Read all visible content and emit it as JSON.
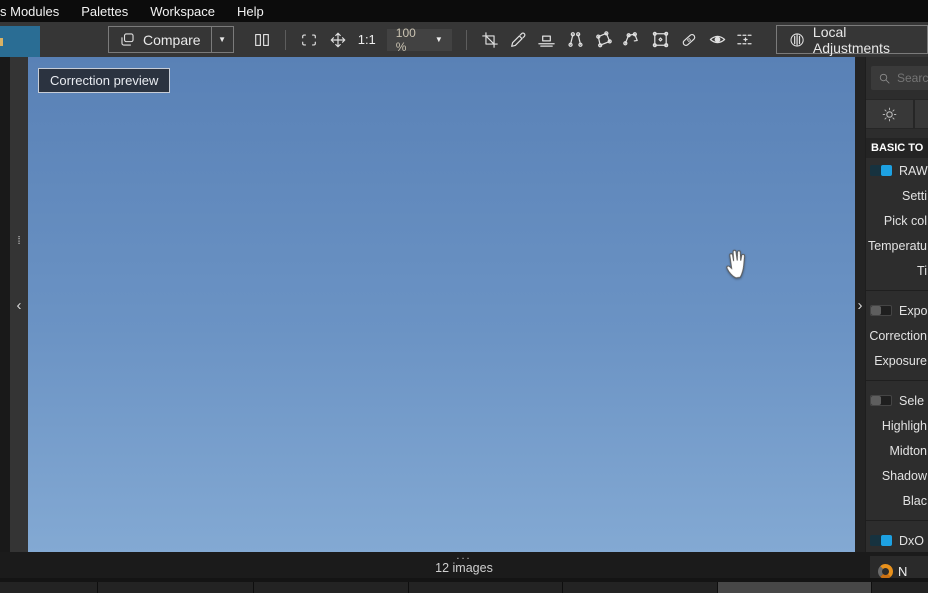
{
  "menubar": {
    "items": [
      {
        "label": "s Modules"
      },
      {
        "label": "Palettes"
      },
      {
        "label": "Workspace"
      },
      {
        "label": "Help"
      }
    ]
  },
  "toolbar": {
    "compare_label": "Compare",
    "compare_arrow": "▼",
    "zoom_ratio_label": "1:1",
    "zoom_level": "100 %",
    "zoom_arrow": "▼",
    "local_adjustments_label": "Local Adjustments",
    "tools": [
      "split-view",
      "fit-to-screen",
      "pan",
      "crop",
      "white-balance-picker",
      "horizon",
      "force-parallel-lines",
      "perspective-4-point",
      "free-perspective",
      "rectangle-perspective",
      "repair",
      "red-eye",
      "miniature-effect"
    ]
  },
  "viewer": {
    "overlay_badge": "Correction preview"
  },
  "left_rail": {
    "grip": "⁞",
    "collapse": "‹"
  },
  "right_rail": {
    "collapse": "›"
  },
  "right_panel": {
    "search_placeholder": "Searc",
    "section_header": "BASIC TO",
    "rows": [
      {
        "label": "RAW",
        "toggle": "on"
      },
      {
        "label": "Setti"
      },
      {
        "label": "Pick col"
      },
      {
        "label": "Temperatu"
      },
      {
        "label": "Ti"
      },
      {
        "label": "Expo",
        "toggle": "off"
      },
      {
        "label": "Correction"
      },
      {
        "label": "Exposure"
      },
      {
        "label": "Sele",
        "toggle": "off"
      },
      {
        "label": "Highligh"
      },
      {
        "label": "Midton"
      },
      {
        "label": "Shadow"
      },
      {
        "label": "Blac"
      },
      {
        "label": "DxO",
        "toggle": "on"
      }
    ]
  },
  "bottom_bar": {
    "more_indicator": "...",
    "image_count": "12 images",
    "nik_label": "N"
  },
  "colors": {
    "accent_teal": "#2a6d94",
    "toggle_on_blue": "#1da1e2",
    "sky_top": "#5981b6",
    "sky_bottom": "#83a9d3",
    "nik_orange": "#e8911c"
  }
}
